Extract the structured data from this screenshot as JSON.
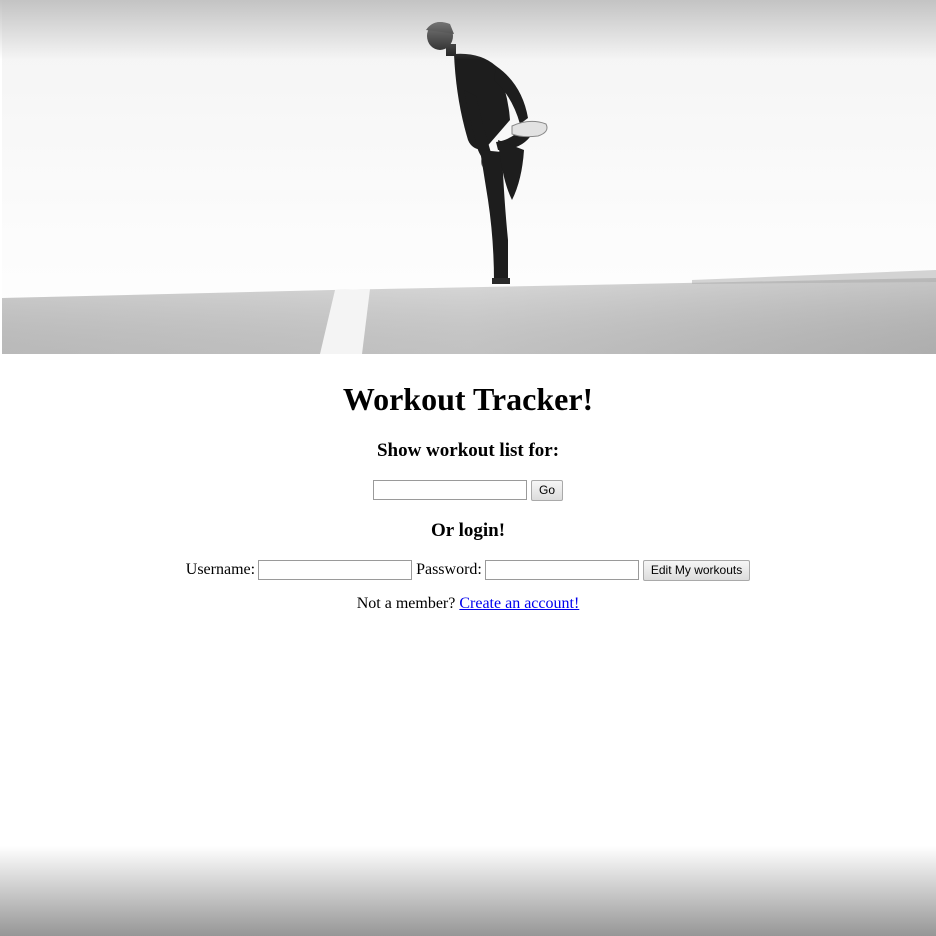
{
  "hero": {
    "image": "man-stretching-on-track-photo"
  },
  "page": {
    "title": "Workout Tracker!"
  },
  "workout_list": {
    "heading": "Show workout list for:",
    "input_value": "",
    "go_label": "Go"
  },
  "login": {
    "heading": "Or login!",
    "username_label": "Username:",
    "username_value": "",
    "password_label": "Password:",
    "password_value": "",
    "submit_label": "Edit My workouts"
  },
  "signup": {
    "prompt": "Not a member?",
    "link_text": "Create an account!"
  },
  "colors": {
    "link": "#0000ee",
    "background": "#ffffff"
  }
}
